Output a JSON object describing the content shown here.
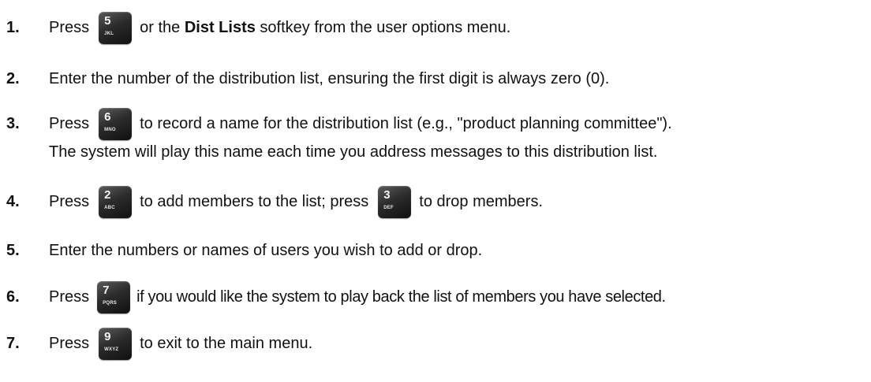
{
  "steps": [
    {
      "number": "1.",
      "press": "Press",
      "key": {
        "digit": "5",
        "letters": "JKL"
      },
      "before_bold": "or the ",
      "bold": "Dist Lists",
      "after_bold": " softkey from the user options menu."
    },
    {
      "number": "2.",
      "text": "Enter the number of the distribution list, ensuring the first digit is always zero (0)."
    },
    {
      "number": "3.",
      "press": "Press",
      "key": {
        "digit": "6",
        "letters": "MNO"
      },
      "text": "to record a name for the distribution list (e.g., \"product planning committee\").",
      "continuation": "The system will play this name each time you address messages to this distribution list."
    },
    {
      "number": "4.",
      "press": "Press",
      "key": {
        "digit": "2",
        "letters": "ABC"
      },
      "text": "to add members to the list; press",
      "key2": {
        "digit": "3",
        "letters": "DEF"
      },
      "text2": "to drop members."
    },
    {
      "number": "5.",
      "text": "Enter the numbers or names of users you wish to add or drop."
    },
    {
      "number": "6.",
      "press": "Press",
      "key": {
        "digit": "7",
        "letters": "PQRS"
      },
      "text": "if you would like the system to play back the list of members you have selected."
    },
    {
      "number": "7.",
      "press": "Press",
      "key": {
        "digit": "9",
        "letters": "WXYZ"
      },
      "text": "to exit to the main menu."
    }
  ]
}
